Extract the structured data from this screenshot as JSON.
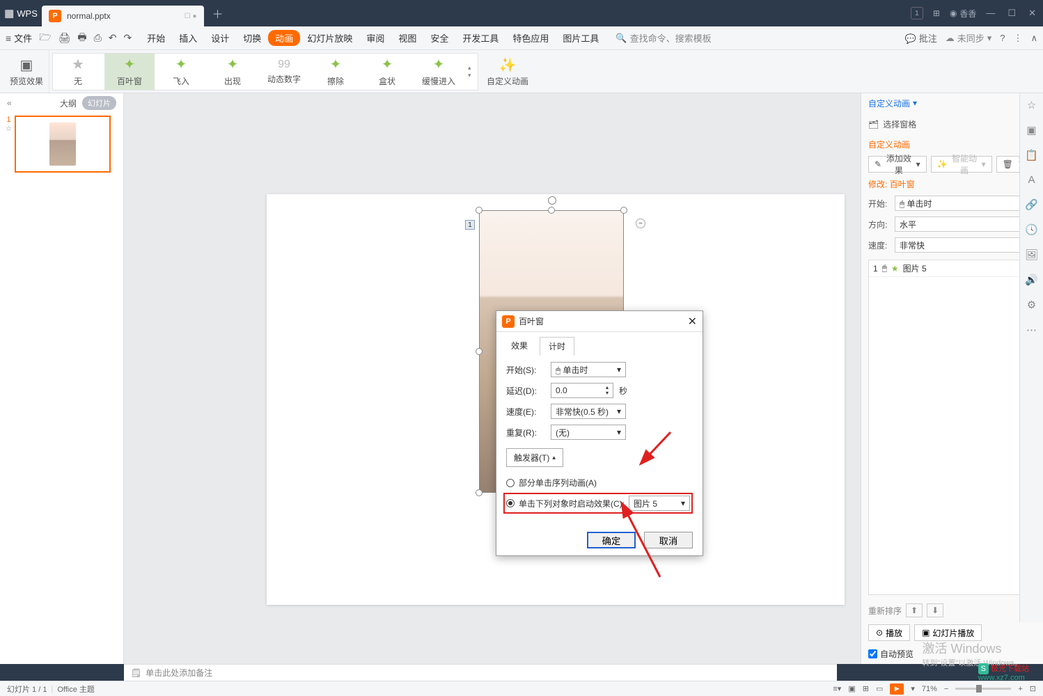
{
  "app": {
    "name": "WPS",
    "user": "香香"
  },
  "tab": {
    "filename": "normal.pptx"
  },
  "menu": {
    "file": "文件",
    "items": [
      "开始",
      "插入",
      "设计",
      "切换",
      "动画",
      "幻灯片放映",
      "审阅",
      "视图",
      "安全",
      "开发工具",
      "特色应用",
      "图片工具"
    ],
    "active": "动画",
    "search": "查找命令、搜索模板",
    "comment": "批注",
    "sync": "未同步"
  },
  "ribbon": {
    "preview": "预览效果",
    "anims": [
      "无",
      "百叶窗",
      "飞入",
      "出现",
      "动态数字",
      "擦除",
      "盒状",
      "缓慢进入"
    ],
    "custom": "自定义动画"
  },
  "slidepanel": {
    "outline": "大纲",
    "slides": "幻灯片",
    "num": "1"
  },
  "canvas": {
    "seq": "1"
  },
  "dialog": {
    "title": "百叶窗",
    "tab_effect": "效果",
    "tab_timing": "计时",
    "start_l": "开始(S):",
    "start_v": "单击时",
    "delay_l": "延迟(D):",
    "delay_v": "0.0",
    "delay_unit": "秒",
    "speed_l": "速度(E):",
    "speed_v": "非常快(0.5 秒)",
    "repeat_l": "重复(R):",
    "repeat_v": "(无)",
    "trigger": "触发器(T)",
    "radio1": "部分单击序列动画(A)",
    "radio2": "单击下列对象时启动效果(C):",
    "trigger_obj": "图片 5",
    "ok": "确定",
    "cancel": "取消"
  },
  "rpanel": {
    "title": "自定义动画",
    "select_pane": "选择窗格",
    "custom_title": "自定义动画",
    "add_effect": "添加效果",
    "smart": "智能动画",
    "delete": "删除",
    "modify": "修改: 百叶窗",
    "start_l": "开始:",
    "start_v": "单击时",
    "dir_l": "方向:",
    "dir_v": "水平",
    "speed_l": "速度:",
    "speed_v": "非常快",
    "list_item": {
      "seq": "1",
      "name": "图片 5"
    },
    "reorder": "重新排序",
    "play": "播放",
    "slideshow": "幻灯片播放",
    "auto_preview": "自动预览"
  },
  "notes": {
    "placeholder": "单击此处添加备注"
  },
  "status": {
    "slide": "幻灯片 1 / 1",
    "theme": "Office 主题",
    "zoom": "71%"
  },
  "watermark": {
    "l1": "激活 Windows",
    "l2": "转到\"设置\"以激活 Windows。",
    "site": "极光下载站",
    "url": "www.xz7.com"
  }
}
